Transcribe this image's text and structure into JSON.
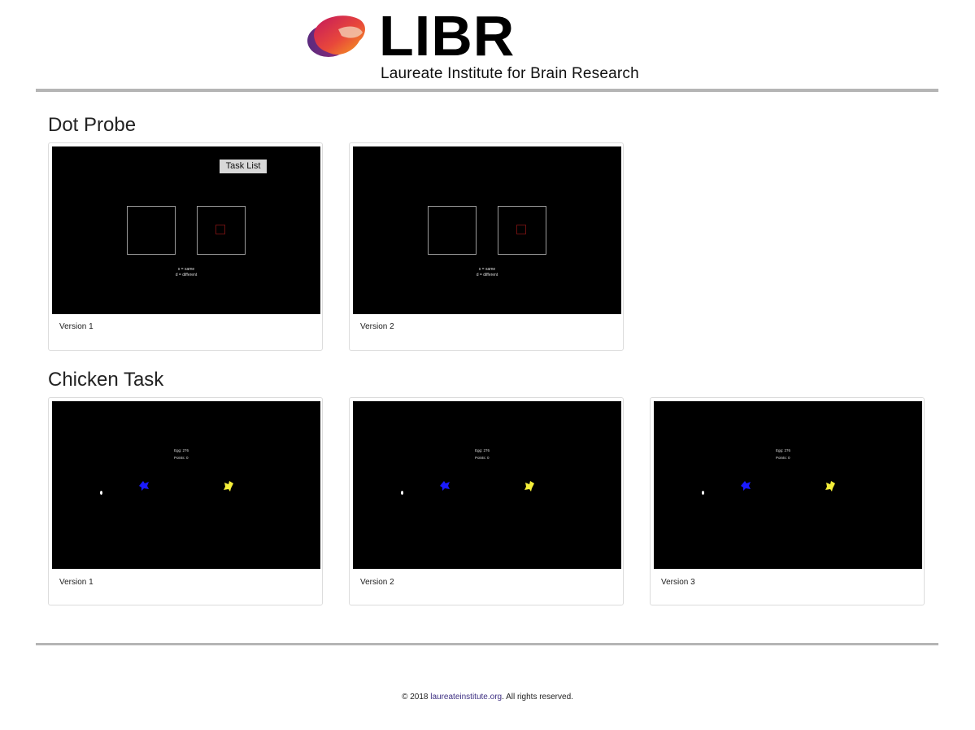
{
  "brand": {
    "name": "LIBR",
    "tagline": "Laureate Institute for Brain Research"
  },
  "sections": [
    {
      "title": "Dot Probe",
      "cards": [
        {
          "label": "Version 1",
          "overlay_button": "Task List",
          "instructions": [
            "s = same",
            "d = different"
          ]
        },
        {
          "label": "Version 2",
          "instructions": [
            "s = same",
            "d = different"
          ]
        }
      ]
    },
    {
      "title": "Chicken Task",
      "cards": [
        {
          "label": "Version 1",
          "hud": [
            "Egg: 276",
            "Points: 0"
          ]
        },
        {
          "label": "Version 2",
          "hud": [
            "Egg: 276",
            "Points: 0"
          ]
        },
        {
          "label": "Version 3",
          "hud": [
            "Egg: 276",
            "Points: 0"
          ]
        }
      ]
    }
  ],
  "footer": {
    "prefix": "© 2018 ",
    "link": "laureateinstitute.org",
    "suffix": ". All rights reserved."
  },
  "colors": {
    "chick_blue": "#1a1aff",
    "chick_yellow": "#f5ef3a",
    "link": "#3d2f82",
    "rule": "#b5b5b5"
  }
}
